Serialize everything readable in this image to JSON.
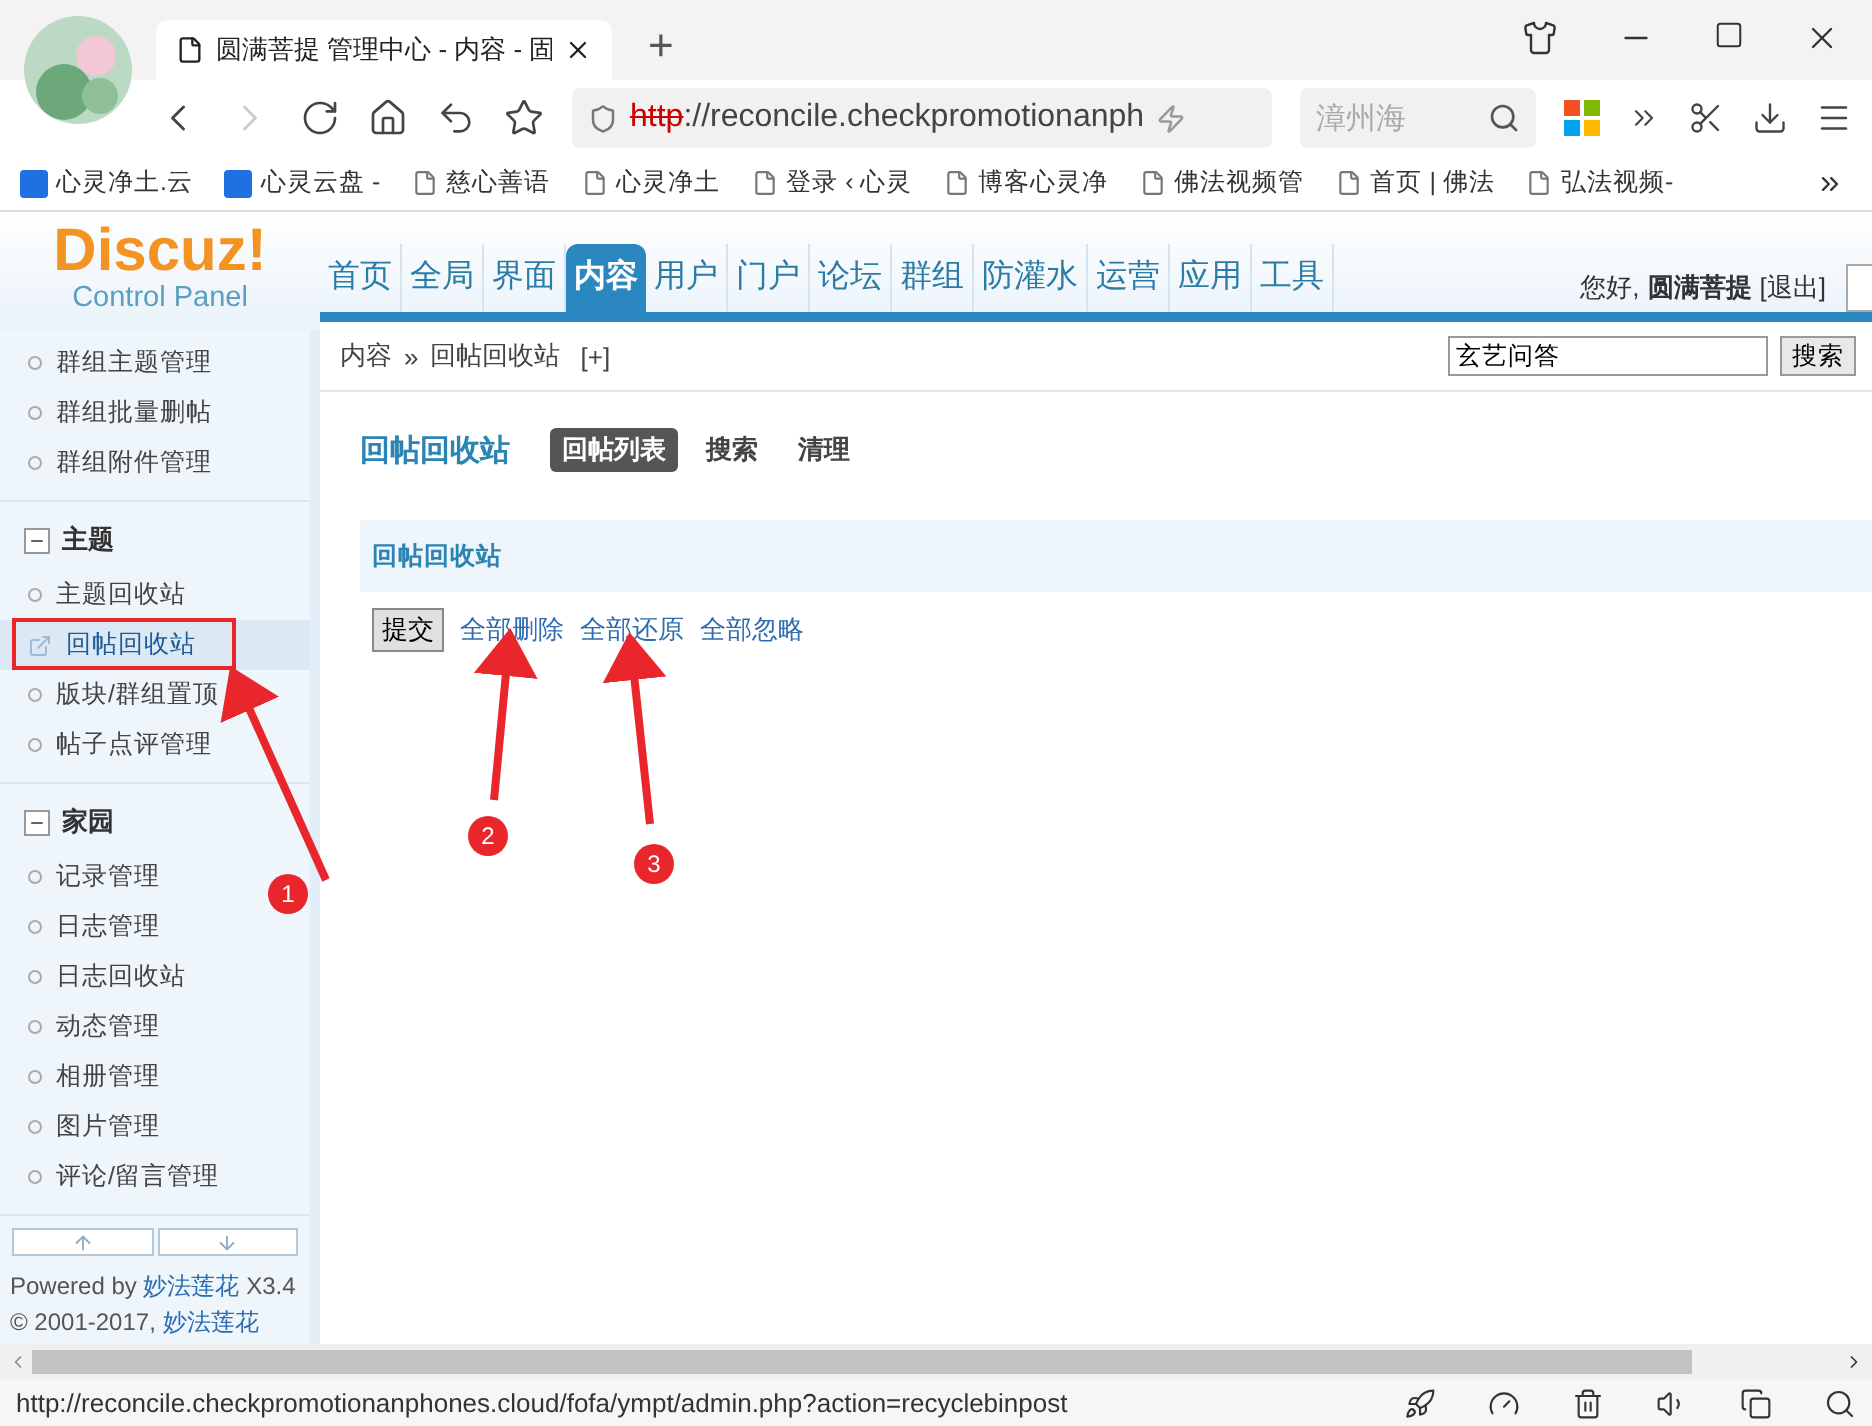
{
  "browser": {
    "tab": {
      "title": "圆满菩提 管理中心 - 内容 - 固"
    },
    "new_tab": "+",
    "address": {
      "scheme": "http",
      "secure": false,
      "rest": "://reconcile.checkpromotionanph"
    },
    "search": {
      "value": "漳州海"
    },
    "bookmarks": [
      {
        "label": "心灵净土.云",
        "kind": "app"
      },
      {
        "label": "心灵云盘 -",
        "kind": "app"
      },
      {
        "label": "慈心善语",
        "kind": "page"
      },
      {
        "label": "心灵净土",
        "kind": "page"
      },
      {
        "label": "登录 ‹ 心灵",
        "kind": "page"
      },
      {
        "label": "博客心灵净",
        "kind": "page"
      },
      {
        "label": "佛法视频管",
        "kind": "page"
      },
      {
        "label": "首页 | 佛法",
        "kind": "page"
      },
      {
        "label": "弘法视频-",
        "kind": "page"
      }
    ]
  },
  "header": {
    "logo": "Discuz!",
    "subtitle": "Control Panel",
    "nav": [
      {
        "label": "首页",
        "selected": false
      },
      {
        "label": "全局",
        "selected": false
      },
      {
        "label": "界面",
        "selected": false
      },
      {
        "label": "内容",
        "selected": true
      },
      {
        "label": "用户",
        "selected": false
      },
      {
        "label": "门户",
        "selected": false
      },
      {
        "label": "论坛",
        "selected": false
      },
      {
        "label": "群组",
        "selected": false
      },
      {
        "label": "防灌水",
        "selected": false
      },
      {
        "label": "运营",
        "selected": false
      },
      {
        "label": "应用",
        "selected": false
      },
      {
        "label": "工具",
        "selected": false
      }
    ],
    "greeting": "您好,",
    "user": "圆满菩提",
    "logout": "[退出]"
  },
  "breadcrumb": {
    "section": "内容",
    "separator": "»",
    "page": "回帖回收站",
    "add": "[+]",
    "search_value": "玄艺问答",
    "search_button": "搜索"
  },
  "sidebar": {
    "groups": [
      {
        "items": [
          {
            "label": "群组主题管理",
            "selected": false
          },
          {
            "label": "群组批量删帖",
            "selected": false
          },
          {
            "label": "群组附件管理",
            "selected": false
          }
        ]
      },
      {
        "title": "主题",
        "expanded": true,
        "items": [
          {
            "label": "主题回收站",
            "selected": false
          },
          {
            "label": "回帖回收站",
            "selected": true
          },
          {
            "label": "版块/群组置顶",
            "selected": false
          },
          {
            "label": "帖子点评管理",
            "selected": false
          }
        ]
      },
      {
        "title": "家园",
        "expanded": true,
        "items": [
          {
            "label": "记录管理",
            "selected": false
          },
          {
            "label": "日志管理",
            "selected": false
          },
          {
            "label": "日志回收站",
            "selected": false
          },
          {
            "label": "动态管理",
            "selected": false
          },
          {
            "label": "相册管理",
            "selected": false
          },
          {
            "label": "图片管理",
            "selected": false
          },
          {
            "label": "评论/留言管理",
            "selected": false
          }
        ]
      }
    ],
    "powered_by": "Powered by",
    "powered_link": "妙法莲花",
    "version": "X3.4",
    "copyright": "© 2001-2017,",
    "copyright_link": "妙法莲花"
  },
  "main": {
    "title": "回帖回收站",
    "tabs": [
      {
        "label": "回帖列表",
        "selected": true
      },
      {
        "label": "搜索",
        "selected": false
      },
      {
        "label": "清理",
        "selected": false
      }
    ],
    "section": "回帖回收站",
    "submit": "提交",
    "actions": [
      "全部删除",
      "全部还原",
      "全部忽略"
    ]
  },
  "annotations": [
    {
      "kind": "frame"
    },
    {
      "kind": "marker",
      "number": "1"
    },
    {
      "kind": "marker",
      "number": "2"
    },
    {
      "kind": "marker",
      "number": "3"
    }
  ],
  "status_bar": {
    "url": "http://reconcile.checkpromotionanphones.cloud/fofa/ympt/admin.php?action=recyclebinpost"
  }
}
